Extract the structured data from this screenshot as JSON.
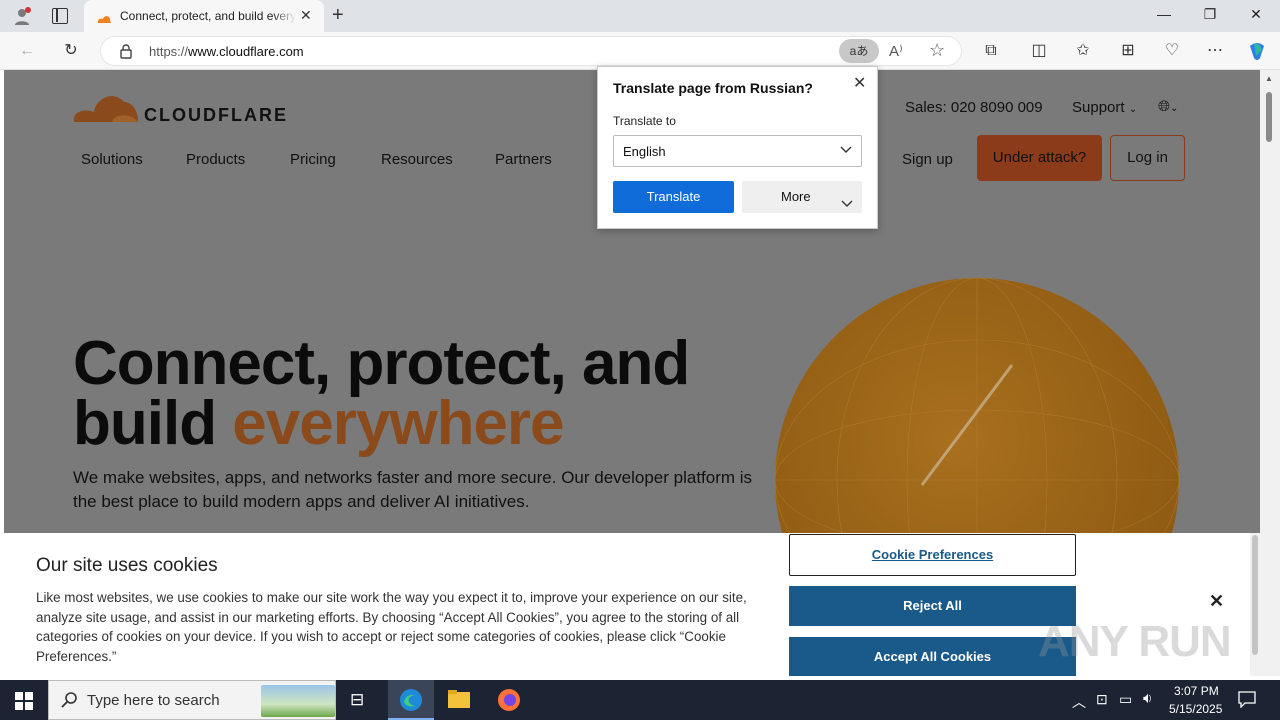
{
  "browser": {
    "tab_title": "Connect, protect, and build everywhere",
    "new_tab_icon": "plus-icon",
    "url_prefix": "https://",
    "url_host": "www.cloudflare.com"
  },
  "site": {
    "logo_text": "CLOUDFLARE",
    "sales": "Sales: 020 8090 009",
    "support": "Support",
    "nav": [
      "Solutions",
      "Products",
      "Pricing",
      "Resources",
      "Partners"
    ],
    "signup": "Sign up",
    "under_attack": "Under attack?",
    "login": "Log in",
    "hero_line1": "Connect, protect, and",
    "hero_line2a": "build ",
    "hero_line2b": "everywhere",
    "hero_sub": "We make websites, apps, and networks faster and more secure. Our developer platform is the best place to build modern apps and deliver AI initiatives."
  },
  "translate": {
    "header": "Translate page from Russian?",
    "label": "Translate to",
    "selected": "English",
    "translate_btn": "Translate",
    "more_btn": "More"
  },
  "cookie": {
    "title": "Our site uses cookies",
    "body": "Like most websites, we use cookies to make our site work the way you expect it to, improve your experience on our site, analyze site usage, and assist in our marketing efforts. By choosing “Accept All Cookies”, you agree to the storing of all categories of cookies on your device. If you wish to accept or reject some categories of cookies, please click “Cookie Preferences.”",
    "preferences": "Cookie Preferences",
    "reject": "Reject All",
    "accept": "Accept All Cookies"
  },
  "watermark": "ANY RUN",
  "taskbar": {
    "search_placeholder": "Type here to search",
    "time": "3:07 PM",
    "date": "5/15/2025"
  },
  "colors": {
    "accent_orange": "#f38020",
    "under_attack_bg": "#8b3a1a",
    "primary_blue": "#0f6cd8",
    "cookie_btn": "#1a5a8a"
  }
}
